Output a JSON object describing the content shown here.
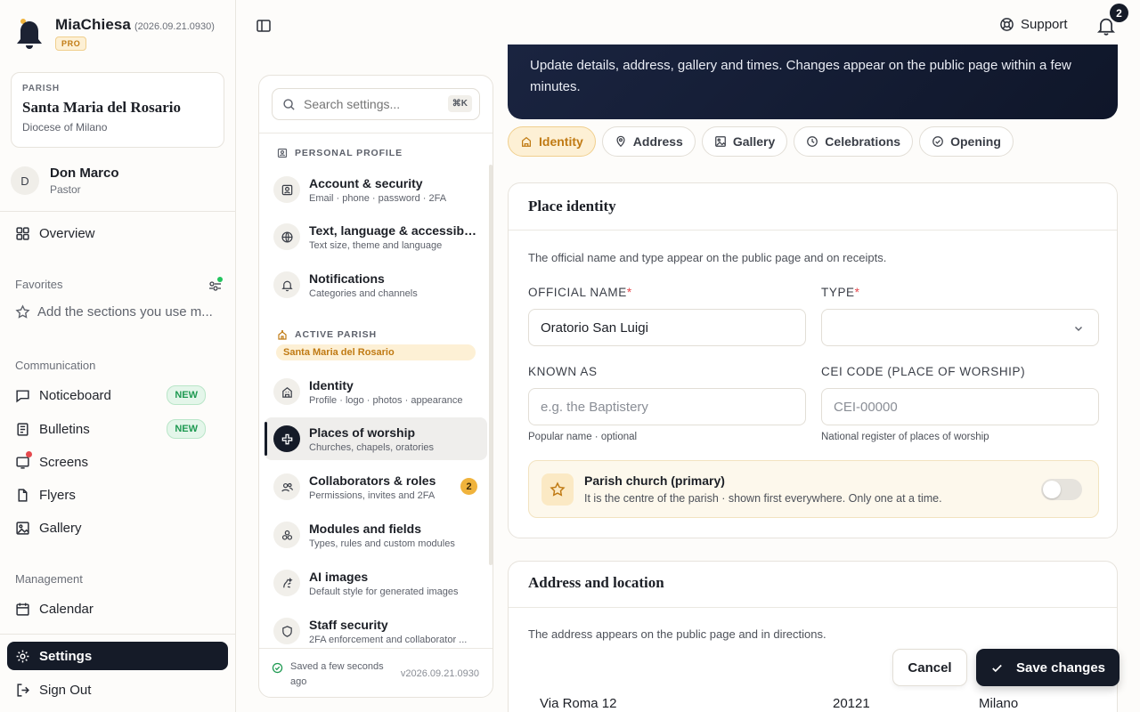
{
  "app": {
    "name": "MiaChiesa",
    "version": "(2026.09.21.0930)",
    "plan": "PRO"
  },
  "parish": {
    "tag": "PARISH",
    "name": "Santa Maria del Rosario",
    "diocese": "Diocese of Milano"
  },
  "user": {
    "initial": "D",
    "name": "Don Marco",
    "role": "Pastor"
  },
  "nav": {
    "overview": "Overview",
    "favorites_title": "Favorites",
    "favorites_hint": "Add the sections you use m...",
    "communication_title": "Communication",
    "noticeboard": "Noticeboard",
    "bulletins": "Bulletins",
    "new_badge": "NEW",
    "screens": "Screens",
    "flyers": "Flyers",
    "gallery": "Gallery",
    "management_title": "Management",
    "calendar": "Calendar",
    "settings": "Settings",
    "sign_out": "Sign Out"
  },
  "header": {
    "support": "Support",
    "notifications_count": "2"
  },
  "settings_panel": {
    "search_placeholder": "Search settings...",
    "shortcut": "⌘K",
    "personal_title": "PERSONAL PROFILE",
    "parish_title": "ACTIVE PARISH",
    "parish_chip": "Santa Maria del Rosario",
    "items": [
      {
        "title": "Account & security",
        "subtitle": "Email · phone · password · 2FA"
      },
      {
        "title": "Text, language & accessibil...",
        "subtitle": "Text size, theme and language"
      },
      {
        "title": "Notifications",
        "subtitle": "Categories and channels"
      },
      {
        "title": "Identity",
        "subtitle": "Profile · logo · photos · appearance"
      },
      {
        "title": "Places of worship",
        "subtitle": "Churches, chapels, oratories"
      },
      {
        "title": "Collaborators & roles",
        "subtitle": "Permissions, invites and 2FA"
      },
      {
        "title": "Modules and fields",
        "subtitle": "Types, rules and custom modules"
      },
      {
        "title": "AI images",
        "subtitle": "Default style for generated images"
      },
      {
        "title": "Staff security",
        "subtitle": "2FA enforcement and collaborator ..."
      }
    ],
    "collaborators_badge": "2",
    "saved_status": "Saved a few seconds ago",
    "version": "v2026.09.21.0930"
  },
  "hero": {
    "text": "Update details, address, gallery and times. Changes appear on the public page within a few minutes."
  },
  "tabs": [
    "Identity",
    "Address",
    "Gallery",
    "Celebrations",
    "Opening"
  ],
  "identity_card": {
    "title": "Place identity",
    "description": "The official name and type appear on the public page and on receipts.",
    "official_name_label": "OFFICIAL NAME",
    "official_name_value": "Oratorio San Luigi",
    "type_label": "TYPE",
    "type_value": "",
    "known_as_label": "KNOWN AS",
    "known_as_placeholder": "e.g. the Baptistery",
    "known_as_help": "Popular name · optional",
    "cei_label": "CEI CODE (PLACE OF WORSHIP)",
    "cei_placeholder": "CEI-00000",
    "cei_help": "National register of places of worship",
    "primary_title": "Parish church (primary)",
    "primary_desc": "It is the centre of the parish · shown first everywhere. Only one at a time.",
    "primary_enabled": false
  },
  "address_card": {
    "title": "Address and location",
    "description": "The address appears on the public page and in directions.",
    "street": "Via Roma 12",
    "zip": "20121",
    "city": "Milano"
  },
  "actions": {
    "cancel": "Cancel",
    "save": "Save changes"
  }
}
